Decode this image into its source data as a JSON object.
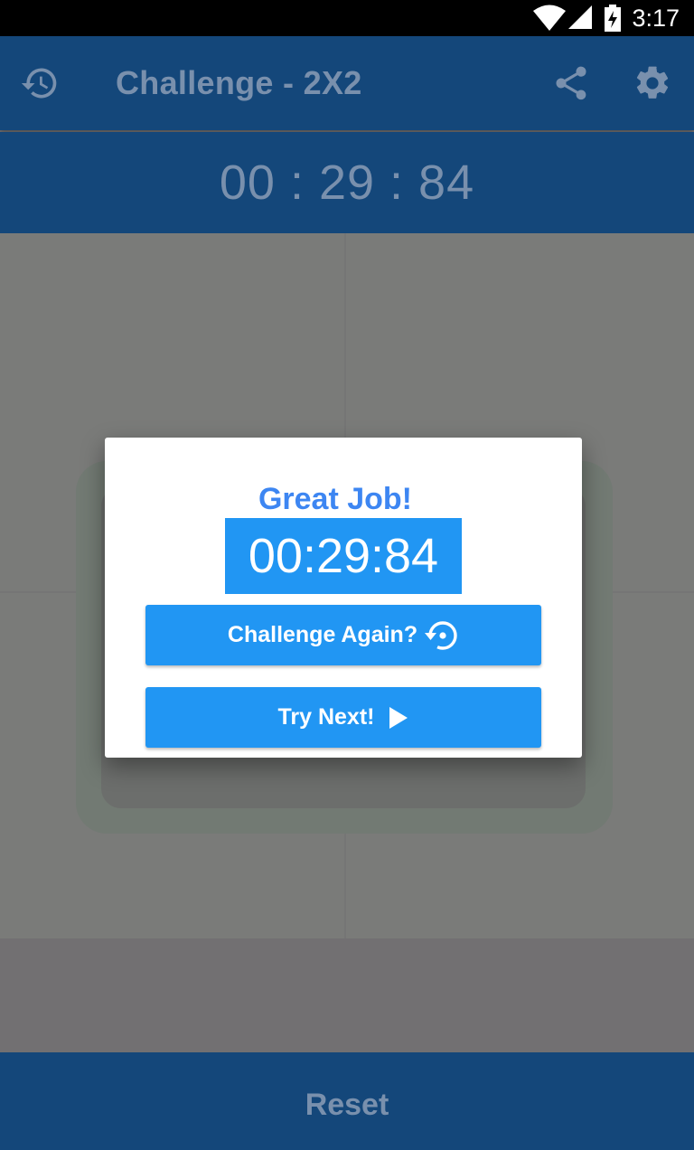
{
  "status_bar": {
    "time": "3:17",
    "icons": [
      "wifi-icon",
      "cell-signal-icon",
      "battery-charging-icon"
    ]
  },
  "app_bar": {
    "title": "Challenge - 2X2",
    "icons": [
      "history-icon",
      "share-icon",
      "settings-icon"
    ]
  },
  "timer": {
    "display": "00 : 29 : 84"
  },
  "dialog": {
    "headline": "Great Job!",
    "time": "00:29:84",
    "challenge_again_label": "Challenge Again?",
    "try_next_label": "Try Next!"
  },
  "bottom": {
    "reset_label": "Reset"
  },
  "colors": {
    "primary_dark": "#14477a",
    "accent": "#2196f3",
    "headline": "#3d86f2",
    "scrim_text": "#7990ad"
  }
}
